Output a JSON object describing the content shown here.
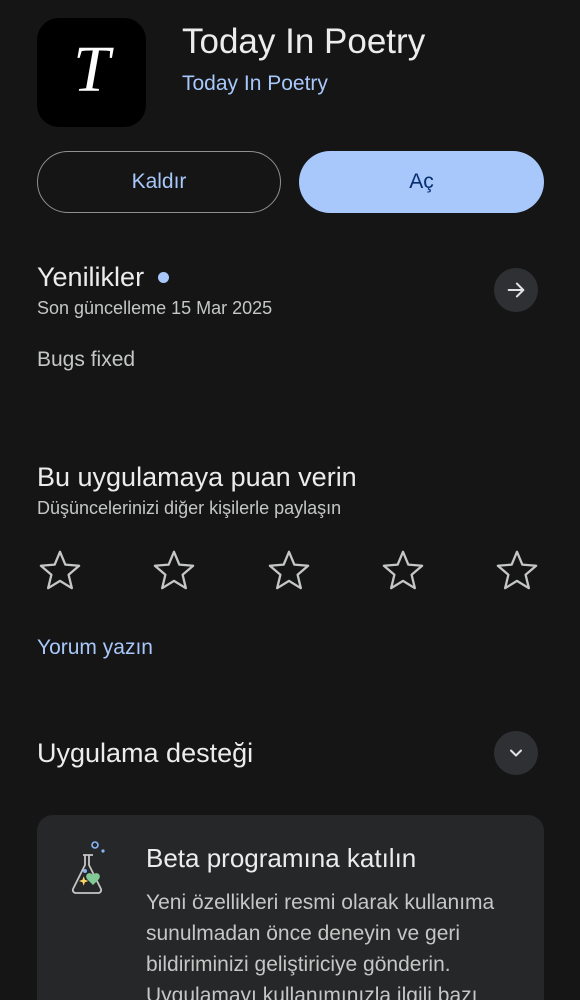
{
  "app": {
    "icon_letter": "T",
    "title": "Today In Poetry",
    "developer": "Today In Poetry"
  },
  "actions": {
    "uninstall_label": "Kaldır",
    "open_label": "Aç"
  },
  "whats_new": {
    "title": "Yenilikler",
    "updated": "Son güncelleme 15 Mar 2025",
    "notes": "Bugs fixed"
  },
  "rating": {
    "title": "Bu uygulamaya puan verin",
    "subtitle": "Düşüncelerinizi diğer kişilerle paylaşın",
    "stars": 5,
    "write_review": "Yorum yazın"
  },
  "support": {
    "title": "Uygulama desteği"
  },
  "beta": {
    "title": "Beta programına katılın",
    "description": "Yeni özellikleri resmi olarak kullanıma sunulmadan önce deneyin ve geri bildiriminizi geliştiriciye gönderin. Uygulamayı kullanımınızla ilgili bazı"
  },
  "colors": {
    "background": "#151516",
    "accent": "#a8c7fa",
    "card": "#262728"
  }
}
